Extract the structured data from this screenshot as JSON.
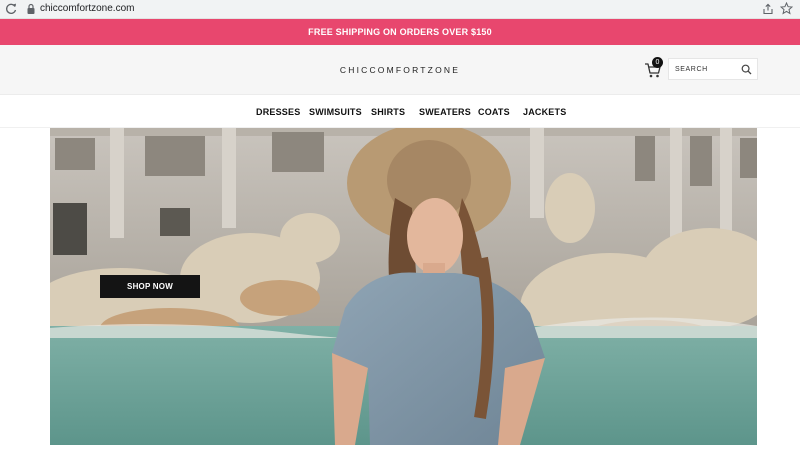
{
  "browser": {
    "url": "chiccomfortzone.com",
    "icons": [
      "reload-icon",
      "lock-icon",
      "share-icon",
      "star-icon"
    ]
  },
  "announcement": {
    "text": "FREE SHIPPING ON ORDERS OVER $150",
    "background": "#e8476e"
  },
  "header": {
    "logo": "CHICCOMFORTZONE",
    "cart_count": "0",
    "search_placeholder": "SEARCH"
  },
  "nav": {
    "items": [
      {
        "label": "DRESSES"
      },
      {
        "label": "SWIMSUITS"
      },
      {
        "label": "SHIRTS"
      },
      {
        "label": "SWEATERS"
      },
      {
        "label": "COATS"
      },
      {
        "label": "JACKETS"
      }
    ]
  },
  "hero": {
    "cta_label": "SHOP NOW",
    "image_subject": "woman in straw hat and chambray shirt dress seated by fountain"
  }
}
